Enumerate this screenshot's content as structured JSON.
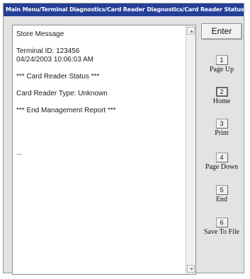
{
  "window": {
    "title": "Main Menu/Terminal Diagnostics/Card Reader Diagnostics/Card Reader Status"
  },
  "report": {
    "text": "Store Message\n\nTerminal ID: 123456\n04/24/2003 10:06:03 AM\n\n*** Card Reader Status ***\n\nCard Reader Type: Unknown\n\n*** End Management Report ***\n\n\n\n\n..."
  },
  "buttons": {
    "enter": "Enter",
    "fkeys": [
      {
        "key": "1",
        "label": "Page Up"
      },
      {
        "key": "2",
        "label": "Home"
      },
      {
        "key": "3",
        "label": "Print"
      },
      {
        "key": "4",
        "label": "Page Down"
      },
      {
        "key": "5",
        "label": "End"
      },
      {
        "key": "6",
        "label": "Save To File"
      }
    ]
  },
  "colors": {
    "titlebar": "#243f96",
    "window_bg": "#e3e3e3"
  }
}
